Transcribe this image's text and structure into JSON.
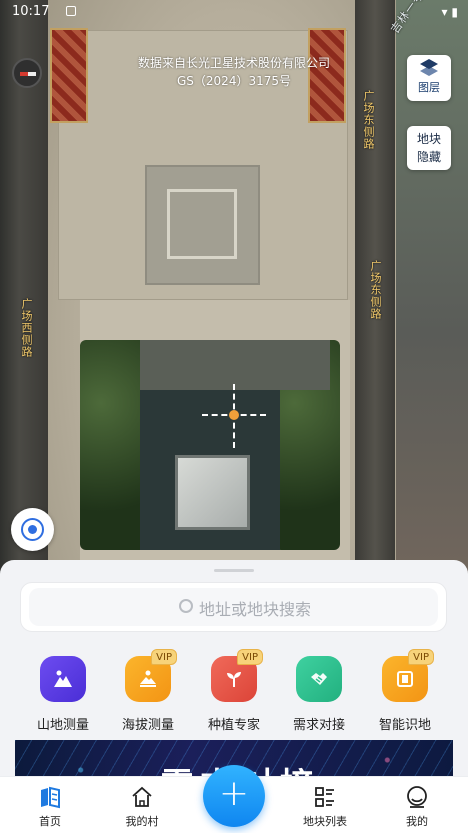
{
  "status": {
    "time": "10:17"
  },
  "map": {
    "credit_line1": "数据来自长光卫星技术股份有限公司",
    "credit_line2": "GS（2024）3175号",
    "road_labels": [
      "广场东侧路",
      "广场东侧路",
      "广场西侧路",
      "吉林一号"
    ]
  },
  "controls": {
    "layers_label": "图层",
    "hide_line1": "地块",
    "hide_line2": "隐藏"
  },
  "search": {
    "placeholder": "地址或地块搜索"
  },
  "quick_actions": [
    {
      "label": "山地测量",
      "vip": ""
    },
    {
      "label": "海拔测量",
      "vip": "VIP"
    },
    {
      "label": "种植专家",
      "vip": "VIP"
    },
    {
      "label": "需求对接",
      "vip": ""
    },
    {
      "label": "智能识地",
      "vip": "VIP"
    }
  ],
  "banner": {
    "title": "需求对接"
  },
  "tabs": [
    {
      "label": "首页"
    },
    {
      "label": "我的村"
    },
    {
      "label": "地块列表"
    },
    {
      "label": "我的"
    }
  ],
  "fab": {
    "label": "+"
  },
  "colors": {
    "accent": "#1689f2",
    "icon_purple": "#5b3be6",
    "icon_orange": "#f7a21a",
    "icon_red": "#e8574b",
    "icon_green": "#2fbf8e",
    "vip_gold": "#f7d37a"
  }
}
